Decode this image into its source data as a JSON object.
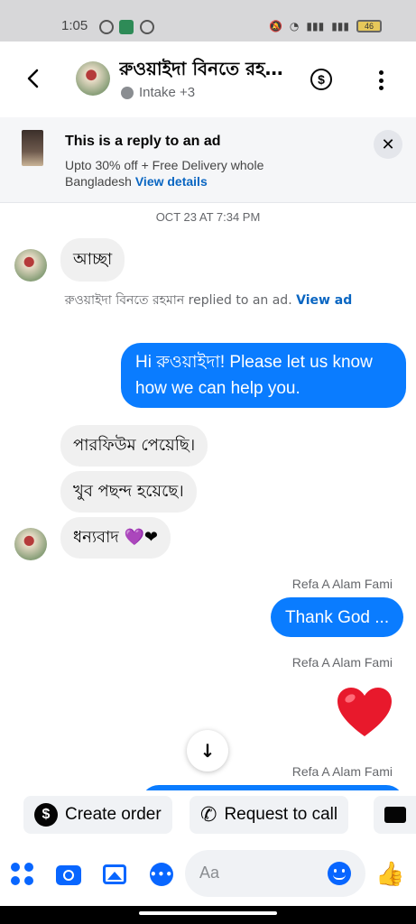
{
  "status_bar": {
    "time": "1:05",
    "battery": "46"
  },
  "header": {
    "title": "রুওয়াইদা বিনতে রহমান",
    "subtitle": "Intake +3"
  },
  "ad_banner": {
    "title": "This is a reply to an ad",
    "description": "Upto 30% off + Free Delivery whole Bangladesh",
    "link": "View details",
    "close": "✕"
  },
  "conversation": {
    "timestamp": "OCT 23 AT 7:34 PM",
    "msg1": "আচ্ছা",
    "note_text": "রুওয়াইদা বিনতে রহমান replied to an ad.",
    "note_link": "View ad",
    "msg2": "Hi রুওয়াইদা! Please let us know how we can help you.",
    "msg3": "পারফিউম পেয়েছি।",
    "msg4": "খুব পছন্দ হয়েছে।",
    "msg5": "ধন্যবাদ 💜❤",
    "sender1": "Refa A Alam Fami",
    "msg6": "Thank God ...",
    "sender2": "Refa A Alam Fami",
    "sender3": "Refa A Alam Fami"
  },
  "actions": {
    "create_order": "Create order",
    "request_call": "Request to call"
  },
  "composer": {
    "placeholder": "Aa"
  },
  "colors": {
    "accent": "#0a7cff",
    "bubble_in": "#f0f0f0"
  }
}
